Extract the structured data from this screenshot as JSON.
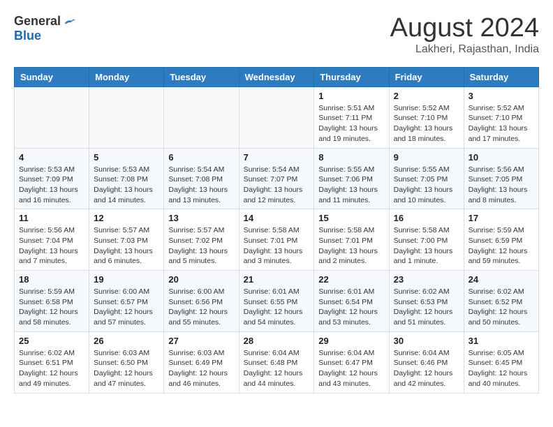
{
  "header": {
    "logo_general": "General",
    "logo_blue": "Blue",
    "month_title": "August 2024",
    "location": "Lakheri, Rajasthan, India"
  },
  "calendar": {
    "days_of_week": [
      "Sunday",
      "Monday",
      "Tuesday",
      "Wednesday",
      "Thursday",
      "Friday",
      "Saturday"
    ],
    "weeks": [
      [
        {
          "day": "",
          "info": ""
        },
        {
          "day": "",
          "info": ""
        },
        {
          "day": "",
          "info": ""
        },
        {
          "day": "",
          "info": ""
        },
        {
          "day": "1",
          "info": "Sunrise: 5:51 AM\nSunset: 7:11 PM\nDaylight: 13 hours and 19 minutes."
        },
        {
          "day": "2",
          "info": "Sunrise: 5:52 AM\nSunset: 7:10 PM\nDaylight: 13 hours and 18 minutes."
        },
        {
          "day": "3",
          "info": "Sunrise: 5:52 AM\nSunset: 7:10 PM\nDaylight: 13 hours and 17 minutes."
        }
      ],
      [
        {
          "day": "4",
          "info": "Sunrise: 5:53 AM\nSunset: 7:09 PM\nDaylight: 13 hours and 16 minutes."
        },
        {
          "day": "5",
          "info": "Sunrise: 5:53 AM\nSunset: 7:08 PM\nDaylight: 13 hours and 14 minutes."
        },
        {
          "day": "6",
          "info": "Sunrise: 5:54 AM\nSunset: 7:08 PM\nDaylight: 13 hours and 13 minutes."
        },
        {
          "day": "7",
          "info": "Sunrise: 5:54 AM\nSunset: 7:07 PM\nDaylight: 13 hours and 12 minutes."
        },
        {
          "day": "8",
          "info": "Sunrise: 5:55 AM\nSunset: 7:06 PM\nDaylight: 13 hours and 11 minutes."
        },
        {
          "day": "9",
          "info": "Sunrise: 5:55 AM\nSunset: 7:05 PM\nDaylight: 13 hours and 10 minutes."
        },
        {
          "day": "10",
          "info": "Sunrise: 5:56 AM\nSunset: 7:05 PM\nDaylight: 13 hours and 8 minutes."
        }
      ],
      [
        {
          "day": "11",
          "info": "Sunrise: 5:56 AM\nSunset: 7:04 PM\nDaylight: 13 hours and 7 minutes."
        },
        {
          "day": "12",
          "info": "Sunrise: 5:57 AM\nSunset: 7:03 PM\nDaylight: 13 hours and 6 minutes."
        },
        {
          "day": "13",
          "info": "Sunrise: 5:57 AM\nSunset: 7:02 PM\nDaylight: 13 hours and 5 minutes."
        },
        {
          "day": "14",
          "info": "Sunrise: 5:58 AM\nSunset: 7:01 PM\nDaylight: 13 hours and 3 minutes."
        },
        {
          "day": "15",
          "info": "Sunrise: 5:58 AM\nSunset: 7:01 PM\nDaylight: 13 hours and 2 minutes."
        },
        {
          "day": "16",
          "info": "Sunrise: 5:58 AM\nSunset: 7:00 PM\nDaylight: 13 hours and 1 minute."
        },
        {
          "day": "17",
          "info": "Sunrise: 5:59 AM\nSunset: 6:59 PM\nDaylight: 12 hours and 59 minutes."
        }
      ],
      [
        {
          "day": "18",
          "info": "Sunrise: 5:59 AM\nSunset: 6:58 PM\nDaylight: 12 hours and 58 minutes."
        },
        {
          "day": "19",
          "info": "Sunrise: 6:00 AM\nSunset: 6:57 PM\nDaylight: 12 hours and 57 minutes."
        },
        {
          "day": "20",
          "info": "Sunrise: 6:00 AM\nSunset: 6:56 PM\nDaylight: 12 hours and 55 minutes."
        },
        {
          "day": "21",
          "info": "Sunrise: 6:01 AM\nSunset: 6:55 PM\nDaylight: 12 hours and 54 minutes."
        },
        {
          "day": "22",
          "info": "Sunrise: 6:01 AM\nSunset: 6:54 PM\nDaylight: 12 hours and 53 minutes."
        },
        {
          "day": "23",
          "info": "Sunrise: 6:02 AM\nSunset: 6:53 PM\nDaylight: 12 hours and 51 minutes."
        },
        {
          "day": "24",
          "info": "Sunrise: 6:02 AM\nSunset: 6:52 PM\nDaylight: 12 hours and 50 minutes."
        }
      ],
      [
        {
          "day": "25",
          "info": "Sunrise: 6:02 AM\nSunset: 6:51 PM\nDaylight: 12 hours and 49 minutes."
        },
        {
          "day": "26",
          "info": "Sunrise: 6:03 AM\nSunset: 6:50 PM\nDaylight: 12 hours and 47 minutes."
        },
        {
          "day": "27",
          "info": "Sunrise: 6:03 AM\nSunset: 6:49 PM\nDaylight: 12 hours and 46 minutes."
        },
        {
          "day": "28",
          "info": "Sunrise: 6:04 AM\nSunset: 6:48 PM\nDaylight: 12 hours and 44 minutes."
        },
        {
          "day": "29",
          "info": "Sunrise: 6:04 AM\nSunset: 6:47 PM\nDaylight: 12 hours and 43 minutes."
        },
        {
          "day": "30",
          "info": "Sunrise: 6:04 AM\nSunset: 6:46 PM\nDaylight: 12 hours and 42 minutes."
        },
        {
          "day": "31",
          "info": "Sunrise: 6:05 AM\nSunset: 6:45 PM\nDaylight: 12 hours and 40 minutes."
        }
      ]
    ]
  }
}
